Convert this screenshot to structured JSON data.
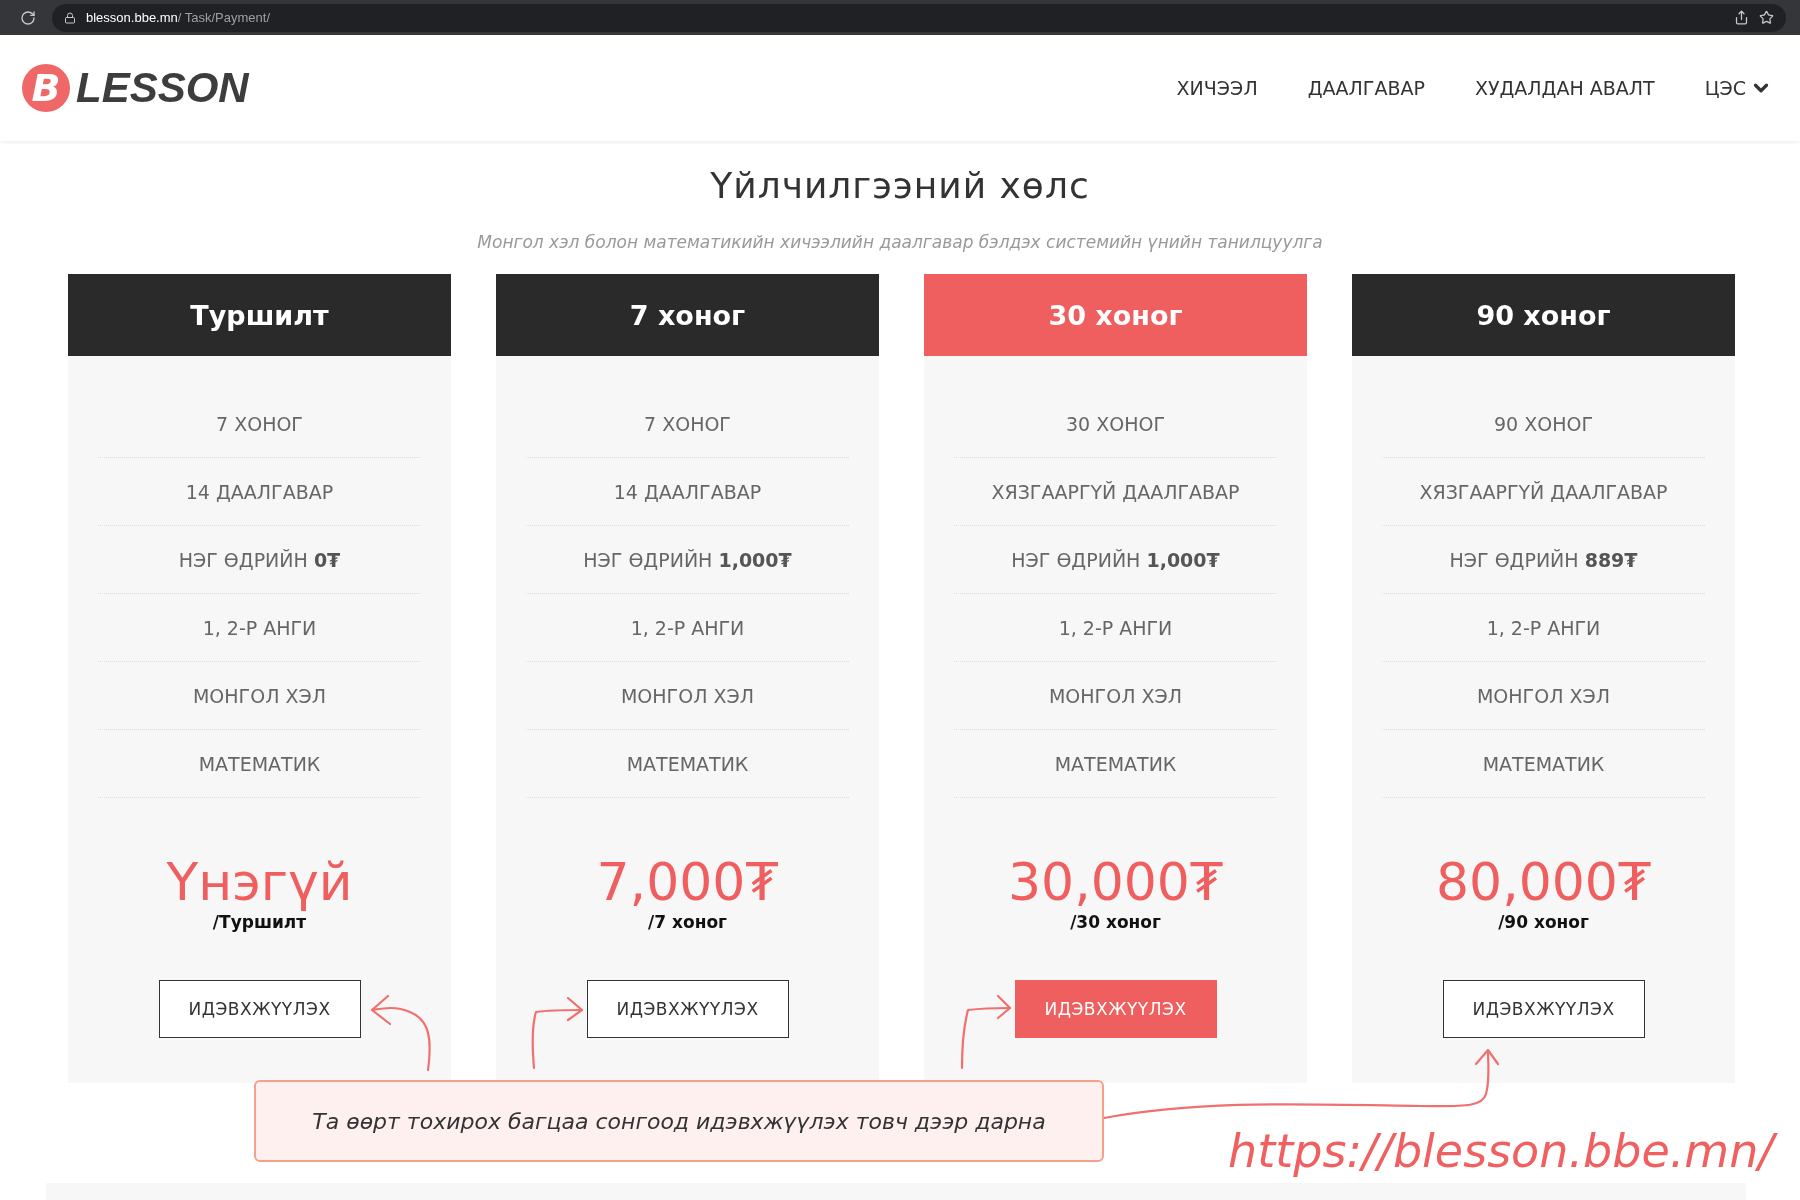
{
  "browser": {
    "domain": "blesson.bbe.mn",
    "path": "/ Task/Payment/"
  },
  "header": {
    "logo_letter": "B",
    "logo_text": "LESSON",
    "nav": [
      {
        "label": "ХИЧЭЭЛ",
        "dropdown": false
      },
      {
        "label": "ДААЛГАВАР",
        "dropdown": false
      },
      {
        "label": "ХУДАЛДАН АВАЛТ",
        "dropdown": false
      },
      {
        "label": "ЦЭС",
        "dropdown": true
      }
    ]
  },
  "title": "Үйлчилгээний хөлс",
  "subtitle": "Монгол хэл болон математикийн хичээлийн даалгавар бэлдэх системийн үнийн танилцуулга",
  "plans": [
    {
      "name": "Туршилт",
      "selected": false,
      "features": [
        "7 ХОНОГ",
        "14 ДААЛГАВАР",
        "НЭГ ӨДРИЙН **0₮**",
        "1, 2-Р АНГИ",
        "МОНГОЛ ХЭЛ",
        "МАТЕМАТИК"
      ],
      "price": "Үнэгүй",
      "period": "/Туршилт",
      "button": "ИДЭВХЖҮҮЛЭХ"
    },
    {
      "name": "7 хоног",
      "selected": false,
      "features": [
        "7 ХОНОГ",
        "14 ДААЛГАВАР",
        "НЭГ ӨДРИЙН **1,000₮**",
        "1, 2-Р АНГИ",
        "МОНГОЛ ХЭЛ",
        "МАТЕМАТИК"
      ],
      "price": "7,000₮",
      "period": "/7 хоног",
      "button": "ИДЭВХЖҮҮЛЭХ"
    },
    {
      "name": "30 хоног",
      "selected": true,
      "features": [
        "30 ХОНОГ",
        "ХЯЗГААРГҮЙ ДААЛГАВАР",
        "НЭГ ӨДРИЙН **1,000₮**",
        "1, 2-Р АНГИ",
        "МОНГОЛ ХЭЛ",
        "МАТЕМАТИК"
      ],
      "price": "30,000₮",
      "period": "/30 хоног",
      "button": "ИДЭВХЖҮҮЛЭХ"
    },
    {
      "name": "90 хоног",
      "selected": false,
      "features": [
        "90 ХОНОГ",
        "ХЯЗГААРГҮЙ ДААЛГАВАР",
        "НЭГ ӨДРИЙН **889₮**",
        "1, 2-Р АНГИ",
        "МОНГОЛ ХЭЛ",
        "МАТЕМАТИК"
      ],
      "price": "80,000₮",
      "period": "/90 хоног",
      "button": "ИДЭВХЖҮҮЛЭХ"
    }
  ],
  "annotation": {
    "text": "Та өөрт тохирох багцаа сонгоод идэвхжүүлэх товч дээр дарна",
    "url": "https://blesson.bbe.mn/"
  }
}
